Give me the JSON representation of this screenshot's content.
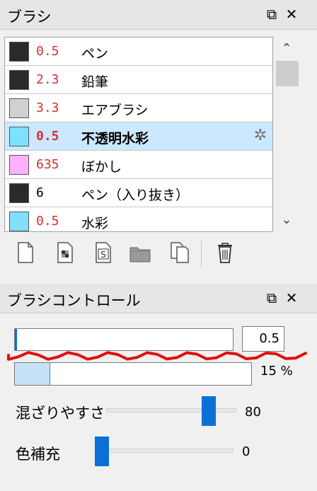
{
  "brush_panel": {
    "title": "ブラシ",
    "float_icon": "⧉",
    "close_icon": "✕",
    "brushes": [
      {
        "color": "#2a2a2a",
        "size": "0.5",
        "size_color": "#d83030",
        "name": "ペン",
        "selected": false
      },
      {
        "color": "#2a2a2a",
        "size": "2.3",
        "size_color": "#d83030",
        "name": "鉛筆",
        "selected": false
      },
      {
        "color": "#d0d0d0",
        "size": "3.3",
        "size_color": "#d83030",
        "name": "エアブラシ",
        "selected": false
      },
      {
        "color": "#7fe0ff",
        "size": "0.5",
        "size_color": "#d83030",
        "name": "不透明水彩",
        "selected": true
      },
      {
        "color": "#ffb0ff",
        "size": "635",
        "size_color": "#d83030",
        "name": "ぼかし",
        "selected": false
      },
      {
        "color": "#2a2a2a",
        "size": "6",
        "size_color": "#000000",
        "name": "ペン（入り抜き）",
        "selected": false
      },
      {
        "color": "#7fe0ff",
        "size": "0.5",
        "size_color": "#d83030",
        "name": "水彩",
        "selected": false
      }
    ],
    "scroll_up": "⌃",
    "scroll_down": "⌄",
    "gear_icon": "✲",
    "toolbar": [
      "new-brush",
      "new-brush-pattern",
      "new-brush-special",
      "folder",
      "copy-brush",
      "delete-brush"
    ]
  },
  "control_panel": {
    "title": "ブラシコントロール",
    "float_icon": "⧉",
    "close_icon": "✕",
    "size_value": "0.5",
    "size_fraction": 0.01,
    "opacity_fraction": 0.15,
    "opacity_label": "15 %",
    "sliders": [
      {
        "label": "混ざりやすさ",
        "value": "80",
        "fraction": 0.8
      },
      {
        "label": "色補充",
        "value": "0",
        "fraction": 0.0
      }
    ]
  },
  "accent_color": "#0a70d8",
  "annotation_color": "#e01010"
}
